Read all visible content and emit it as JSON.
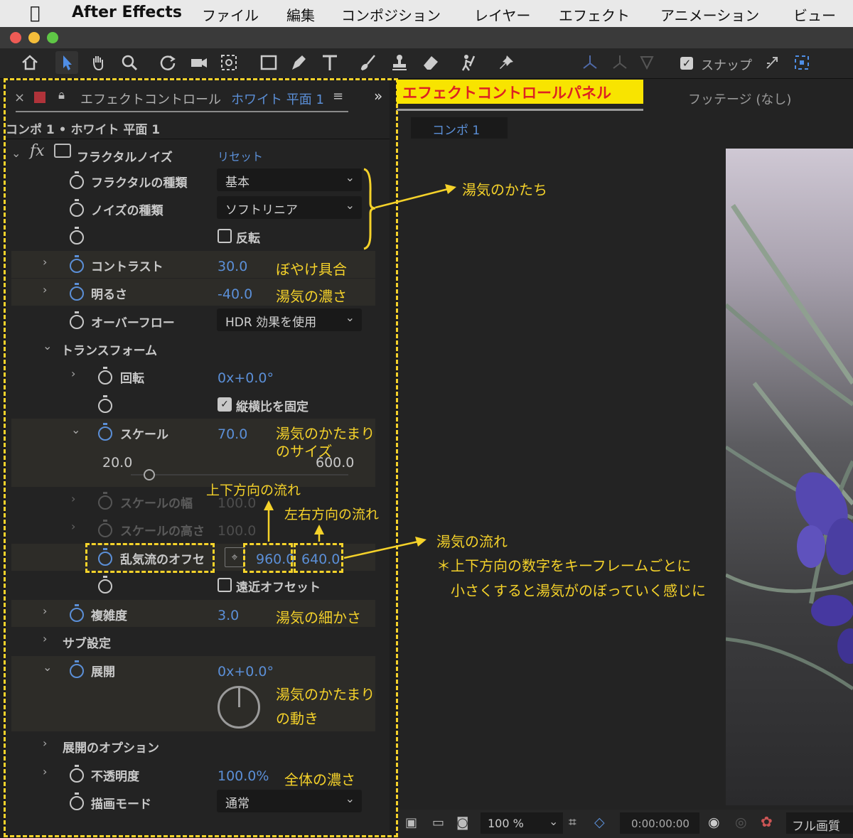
{
  "menubar": {
    "app_name": "After Effects",
    "items": [
      "ファイル",
      "編集",
      "コンポジション",
      "レイヤー",
      "エフェクト",
      "アニメーション",
      "ビュー"
    ]
  },
  "toolbar": {
    "snap_label": "スナップ"
  },
  "effect_panel": {
    "tab_label": "エフェクトコントロール",
    "tab_layer": "ホワイト 平面 1",
    "breadcrumb": "コンポ 1 • ホワイト 平面 1",
    "effect_name": "フラクタルノイズ",
    "reset_label": "リセット",
    "props": {
      "fractal_type": {
        "label": "フラクタルの種類",
        "value": "基本"
      },
      "noise_type": {
        "label": "ノイズの種類",
        "value": "ソフトリニア"
      },
      "invert": {
        "label": "反転"
      },
      "contrast": {
        "label": "コントラスト",
        "value": "30.0"
      },
      "brightness": {
        "label": "明るさ",
        "value": "-40.0"
      },
      "overflow": {
        "label": "オーバーフロー",
        "value": "HDR 効果を使用"
      },
      "transform": {
        "label": "トランスフォーム"
      },
      "rotation": {
        "label": "回転",
        "value": "0x+0.0°"
      },
      "uniform_scaling": {
        "label": "縦横比を固定"
      },
      "scale": {
        "label": "スケール",
        "value": "70.0",
        "slider_min": "20.0",
        "slider_max": "600.0",
        "slider_fraction": 0.086
      },
      "scale_width": {
        "label": "スケールの幅",
        "value": "100.0"
      },
      "scale_height": {
        "label": "スケールの高さ",
        "value": "100.0"
      },
      "offset": {
        "label": "乱気流のオフセ",
        "x": "960.0",
        "y": "640.0"
      },
      "perspective": {
        "label": "遠近オフセット"
      },
      "complexity": {
        "label": "複雑度",
        "value": "3.0"
      },
      "sub_settings": {
        "label": "サブ設定"
      },
      "evolution": {
        "label": "展開",
        "value": "0x+0.0°"
      },
      "evolution_options": {
        "label": "展開のオプション"
      },
      "opacity": {
        "label": "不透明度",
        "value": "100.0%"
      },
      "blend_mode": {
        "label": "描画モード",
        "value": "通常"
      }
    }
  },
  "viewer": {
    "footage_tab": "フッテージ (なし)",
    "comp_tab": "コンポ 1",
    "zoom": "100 %",
    "timecode": "0:00:00:00",
    "resolution": "フル画質"
  },
  "annotations": {
    "panel_title": "エフェクトコントロールパネル",
    "shape": "湯気のかたち",
    "blur": "ぼやけ具合",
    "density": "湯気の濃さ",
    "blob_size_1": "湯気のかたまり",
    "blob_size_2": "のサイズ",
    "vertical_flow": "上下方向の流れ",
    "horizontal_flow": "左右方向の流れ",
    "flow": "湯気の流れ",
    "flow_note_1": "＊上下方向の数字をキーフレームごとに",
    "flow_note_2": "小さくすると湯気がのぼっていく感じに",
    "fineness": "湯気の細かさ",
    "blob_motion_1": "湯気のかたまり",
    "blob_motion_2": "の動き",
    "overall_density": "全体の濃さ"
  },
  "colors": {
    "annotation": "#f5d22a",
    "value_blue": "#5b8fd7",
    "badge_bg": "#f8e400",
    "badge_text": "#dd2222"
  }
}
